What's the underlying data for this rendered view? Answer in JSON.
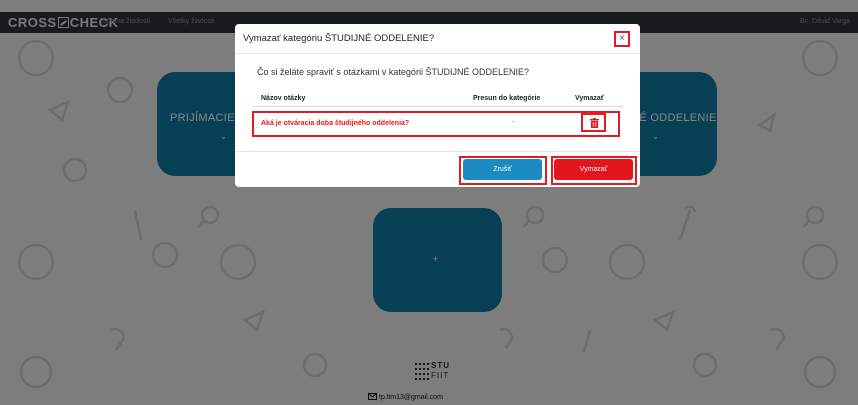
{
  "navbar": {
    "brand": "CROSSCHECK",
    "brand_pre": "CROSS",
    "brand_post": "CHECK",
    "links": [
      "Správa žiadostí",
      "Všetky žiadosti"
    ],
    "user": "Bc. Dávid Varga"
  },
  "categories": [
    {
      "title": "PRIJÍMACIE KONANIE",
      "short": "PRIJÍMACIE KO"
    },
    {
      "title": "ŠTUDIJNÉ ODDELENIE",
      "short": "IÉ ODDELENIE"
    },
    {
      "title": "+"
    }
  ],
  "modal": {
    "title": "Vymazať kategóriu ŠTUDIJNÉ ODDELENIE?",
    "close_label": "×",
    "question": "Čo si želáte spraviť s otázkami v kategórii ŠTUDIJNÉ ODDELENIE?",
    "table": {
      "headers": [
        "Názov otázky",
        "Presun do kategórie",
        "Vymazať"
      ],
      "rows": [
        {
          "question": "Aká je otváracia doba študijného oddelenia?",
          "move": "-"
        }
      ]
    },
    "cancel_label": "Zrušiť",
    "delete_label": "Vymazať"
  },
  "footer": {
    "logo_top": "STU",
    "logo_bottom": "FIIT",
    "email": "tp.tim13@gmail.com"
  },
  "colors": {
    "navbar": "#2d3338",
    "card": "#0e77a0",
    "cancel": "#1a8cc2",
    "delete": "#e3161e",
    "highlight": "#e31b23"
  },
  "icons": [
    "trash-icon",
    "mail-icon",
    "chevron-down-icon",
    "close-icon"
  ]
}
